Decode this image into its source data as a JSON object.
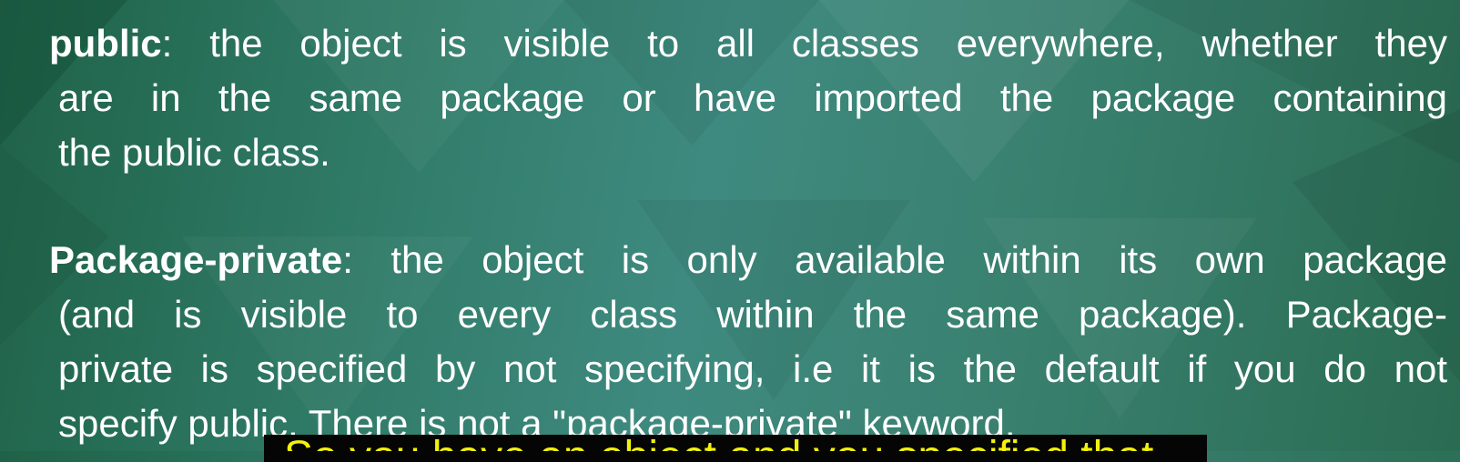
{
  "paragraphs": {
    "public": {
      "keyword": "public",
      "line1": ": the object is visible to all classes everywhere, whether they",
      "line2": "are in the same package or have imported the package containing",
      "line3": "the public class."
    },
    "package_private": {
      "keyword": "Package-private",
      "line1": ": the object is only available within its own package",
      "line2": "(and is visible to every class within the same package). Package-",
      "line3": "private is specified by not specifying, i.e it is the default if you do not",
      "line4": "specify public. There is not a \"package-private\" keyword."
    }
  },
  "caption": {
    "text": "So you have an object and you specified that"
  },
  "colors": {
    "text": "#ffffff",
    "caption_text": "#f2f20a",
    "caption_background": "#050505",
    "background": "#3a8373"
  }
}
